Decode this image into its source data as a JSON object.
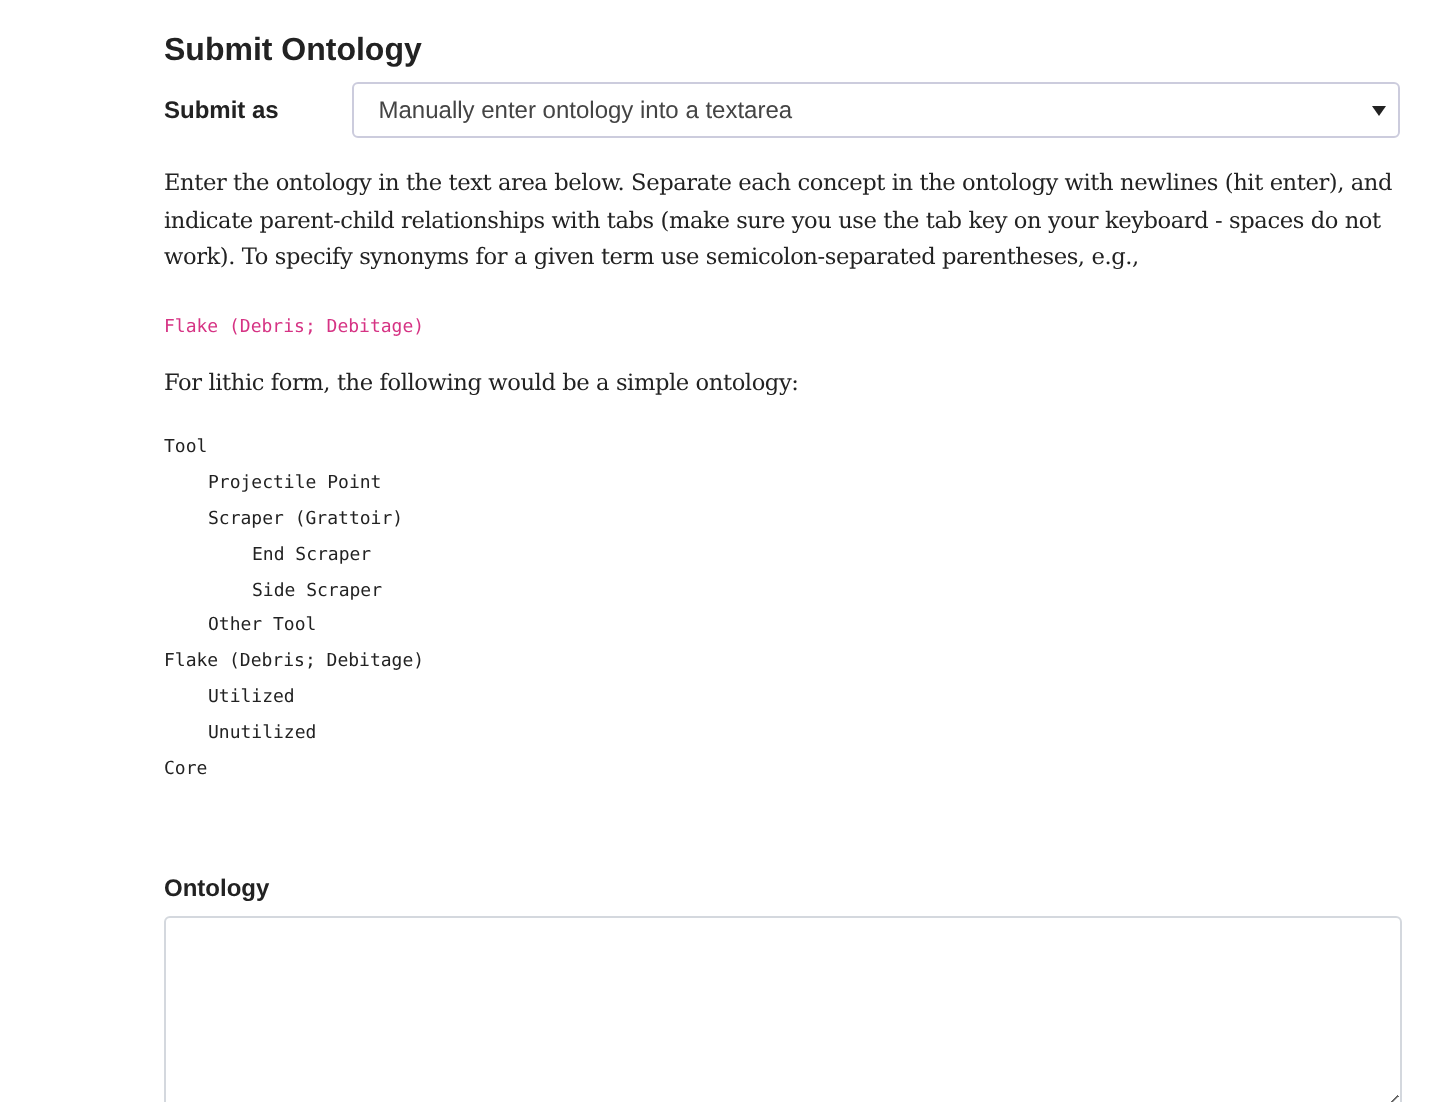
{
  "title": "Submit Ontology",
  "submit_as": {
    "label": "Submit as",
    "value": "Manually enter ontology into a textarea"
  },
  "instructions": "Enter the ontology in the text area below. Separate each concept in the ontology with newlines (hit enter), and indicate parent-child relationships with tabs (make sure you use the tab key on your keyboard - spaces do not work). To specify synonyms for a given term use semicolon-separated parentheses, e.g.,",
  "synonym_example": "Flake (Debris; Debitage)",
  "example_intro": "For lithic form, the following would be a simple ontology:",
  "example_tree": [
    {
      "label": "Tool",
      "children": [
        {
          "label": "Projectile Point"
        },
        {
          "label": "Scraper (Grattoir)",
          "children": [
            {
              "label": "End Scraper"
            },
            {
              "label": "Side Scraper"
            }
          ]
        },
        {
          "label": "Other Tool"
        }
      ]
    },
    {
      "label": "Flake (Debris; Debitage)",
      "children": [
        {
          "label": "Utilized"
        },
        {
          "label": "Unutilized"
        }
      ]
    },
    {
      "label": "Core"
    }
  ],
  "ontology_field": {
    "label": "Ontology"
  }
}
